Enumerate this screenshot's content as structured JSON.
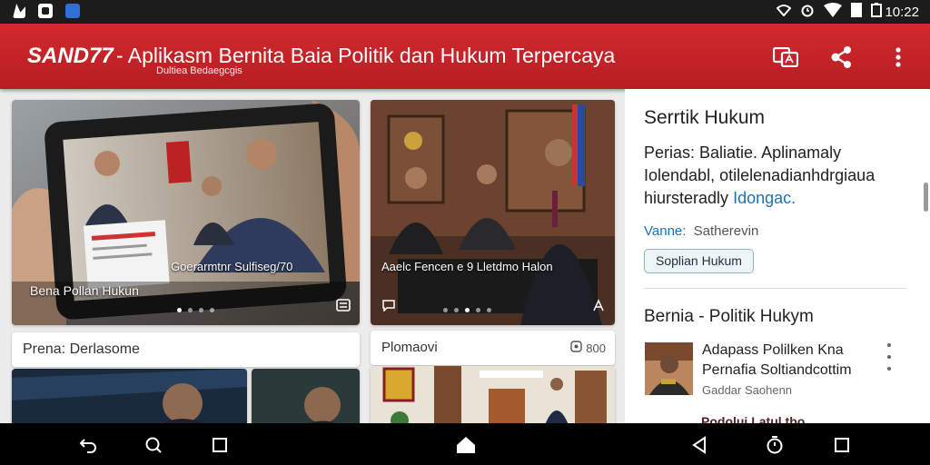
{
  "status_bar": {
    "time": "10:22"
  },
  "app_bar": {
    "brand": "SAND77",
    "title": "- Aplikasm Bernita Baia Politik dan Hukum Terpercaya",
    "subtitle": "Dultiea Bedaegcgis"
  },
  "cards": [
    {
      "caption": "Bena Pollan Hukun",
      "overlay": "Goerarmtnr Sulfiseg/70"
    },
    {
      "caption": "Aaelc Fencen e 9 Lletdmo Halon"
    }
  ],
  "strips": [
    {
      "label": "Prena: Derlasome"
    },
    {
      "label": "Plomaovi",
      "count": "800"
    }
  ],
  "sidebar": {
    "section_title": "Serrtik Hukum",
    "text_line1": "Perias: Baliatie. Aplinamaly",
    "text_line2": "Iolendabl, otilelenadianhdrgiaua",
    "text_line3_plain": "hiursteradly",
    "text_line3_link": "Idongac.",
    "meta_label": "Vanne:",
    "meta_value": "Satherevin",
    "chip_label": "Soplian Hukum",
    "section2_title": "Bernia - Politik Hukym",
    "item1_title1": "Adapass Polilken Kna",
    "item1_title2": "Pernafia Soltiandcottim",
    "item1_meta": "Gaddar Saohenn",
    "item2_partial": "Podolui Latul tbo"
  },
  "colors": {
    "app_bar": "#c4232a",
    "link": "#1a73b8",
    "chip_border": "#8cb4c8"
  }
}
